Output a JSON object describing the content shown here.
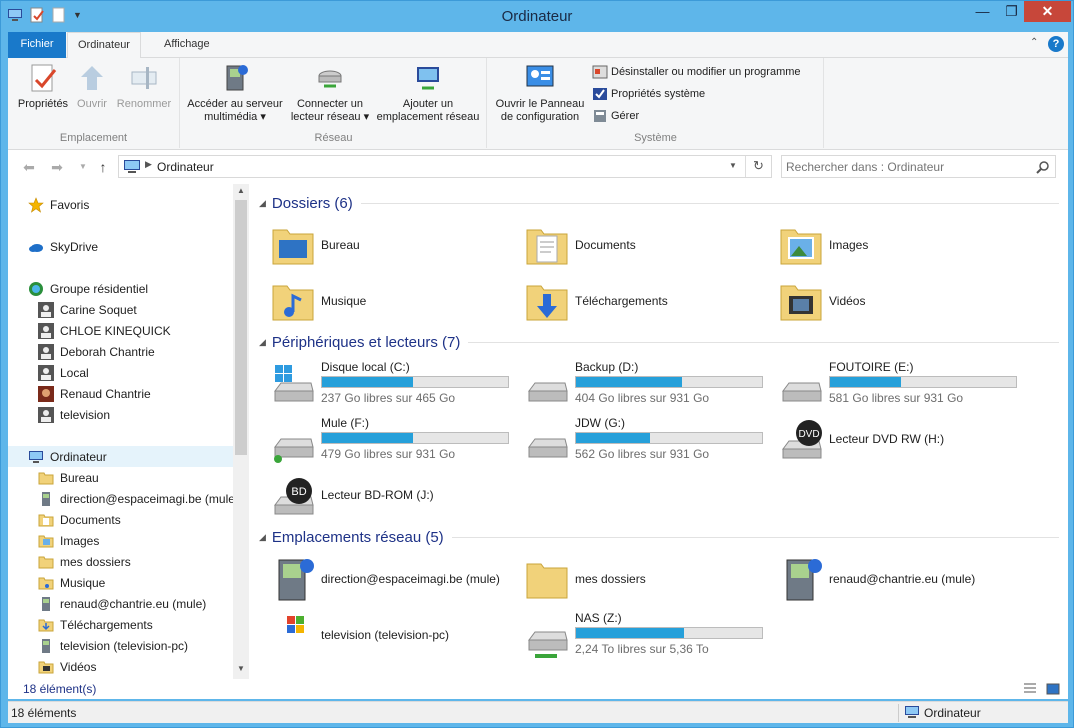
{
  "window": {
    "title": "Ordinateur"
  },
  "ribbon_tabs": [
    "Fichier",
    "Ordinateur",
    "Affichage"
  ],
  "ribbon": {
    "emplacement": {
      "label": "Emplacement",
      "buttons": [
        "Propriétés",
        "Ouvrir",
        "Renommer"
      ]
    },
    "reseau": {
      "label": "Réseau",
      "acceder": [
        "Accéder au serveur",
        "multimédia ▾"
      ],
      "connecter": [
        "Connecter un",
        "lecteur réseau ▾"
      ],
      "ajouter": [
        "Ajouter un",
        "emplacement réseau"
      ]
    },
    "systeme": {
      "label": "Système",
      "panneau": [
        "Ouvrir le Panneau",
        "de configuration"
      ],
      "small": [
        "Désinstaller ou modifier un programme",
        "Propriétés système",
        "Gérer"
      ]
    }
  },
  "address": {
    "path": "Ordinateur",
    "search_placeholder": "Rechercher dans : Ordinateur"
  },
  "nav": {
    "favoris": "Favoris",
    "skydrive": "SkyDrive",
    "groupe": "Groupe résidentiel",
    "users": [
      "Carine Soquet",
      "CHLOE KINEQUICK",
      "Deborah Chantrie",
      "Local",
      "Renaud Chantrie",
      "television"
    ],
    "ordinateur": "Ordinateur",
    "children": [
      "Bureau",
      "direction@espaceimagi.be (mule)",
      "Documents",
      "Images",
      "mes dossiers",
      "Musique",
      "renaud@chantrie.eu (mule)",
      "Téléchargements",
      "television (television-pc)",
      "Vidéos"
    ]
  },
  "sections": {
    "dossiers": "Dossiers (6)",
    "peripheriques": "Périphériques et lecteurs (7)",
    "reseau": "Emplacements réseau (5)"
  },
  "folders": [
    "Bureau",
    "Documents",
    "Images",
    "Musique",
    "Téléchargements",
    "Vidéos"
  ],
  "drives": [
    {
      "name": "Disque local (C:)",
      "free": "237 Go libres sur 465 Go",
      "used_fraction": 0.49
    },
    {
      "name": "Backup (D:)",
      "free": "404 Go libres sur 931 Go",
      "used_fraction": 0.57
    },
    {
      "name": "FOUTOIRE (E:)",
      "free": "581 Go libres sur 931 Go",
      "used_fraction": 0.38
    },
    {
      "name": "Mule (F:)",
      "free": "479 Go libres sur 931 Go",
      "used_fraction": 0.49
    },
    {
      "name": "JDW (G:)",
      "free": "562 Go libres sur 931 Go",
      "used_fraction": 0.4
    },
    {
      "name": "Lecteur DVD RW (H:)"
    },
    {
      "name": "Lecteur BD-ROM (J:)"
    }
  ],
  "network": [
    {
      "name": "direction@espaceimagi.be (mule)"
    },
    {
      "name": "mes dossiers"
    },
    {
      "name": "renaud@chantrie.eu (mule)"
    },
    {
      "name": "television (television-pc)"
    },
    {
      "name": "NAS (Z:)",
      "free": "2,24 To libres sur 5,36 To",
      "used_fraction": 0.58
    }
  ],
  "status": {
    "count_inner": "18 élément(s)",
    "count": "18 éléments",
    "location": "Ordinateur"
  }
}
